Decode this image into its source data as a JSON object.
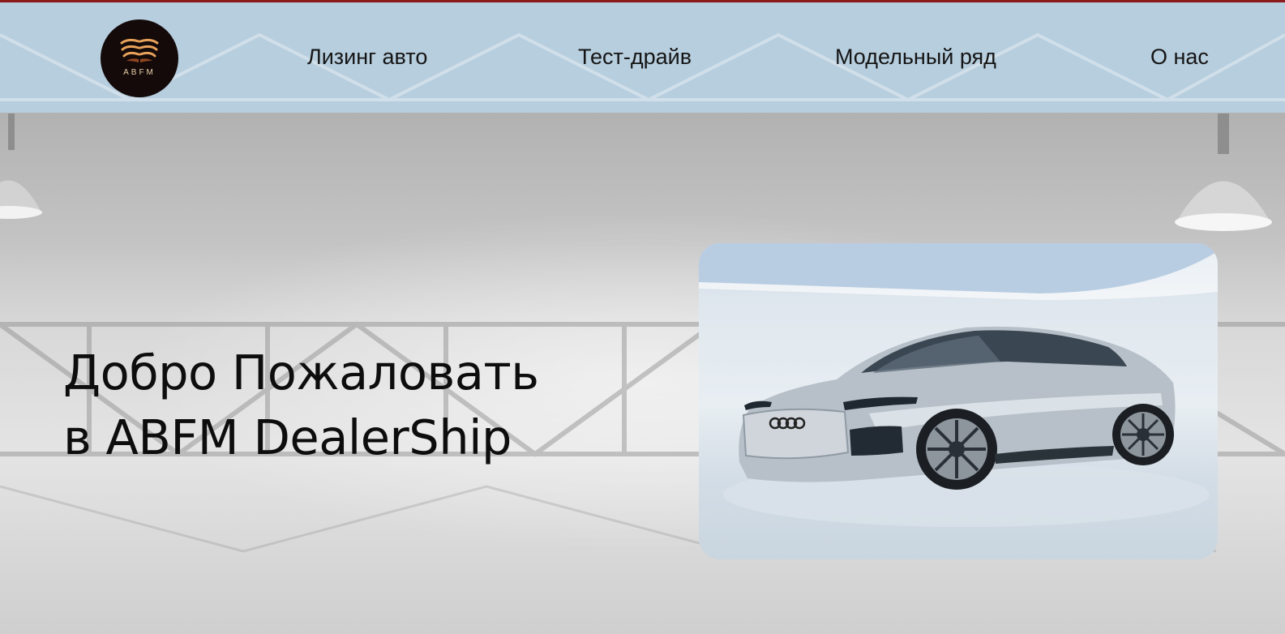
{
  "brand": {
    "logo_text": "ABFM"
  },
  "nav": {
    "items": [
      {
        "label": "Лизинг авто"
      },
      {
        "label": "Тест-драйв"
      },
      {
        "label": "Модельный ряд"
      },
      {
        "label": "О нас"
      }
    ]
  },
  "hero": {
    "title_line_1": "Добро Пожаловать",
    "title_line_2": "в ABFM DealerShip"
  },
  "colors": {
    "header_bg": "#b7cede",
    "header_top_border": "#8c1a1a",
    "logo_bg": "#140a0a",
    "logo_accent": "#e8a25a",
    "text": "#0d0d0d"
  },
  "images": {
    "background": "showroom-interior-photo",
    "hero_car": "silver-audi-sedan-photo"
  }
}
